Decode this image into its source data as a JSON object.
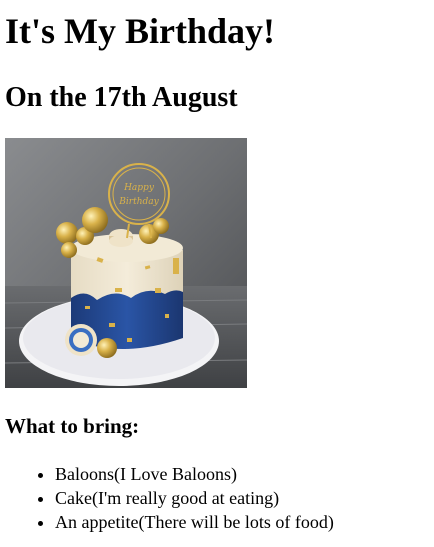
{
  "page": {
    "title": "It's My Birthday!",
    "subtitle": "On the 17th August",
    "image": {
      "alt": "cake-image",
      "topper_text": "Happy Birthday"
    },
    "bring_heading": "What to bring:",
    "bring_items": [
      "Baloons(I Love Baloons)",
      "Cake(I'm really good at eating)",
      "An appetite(There will be lots of food)"
    ]
  },
  "colors": {
    "background_wall": "#6d6f72",
    "cake_cream": "#efe6d2",
    "cake_blue": "#23488f",
    "gold": "#d9b24a",
    "plate": "#f4f4f6",
    "table": "#5b5d60"
  }
}
